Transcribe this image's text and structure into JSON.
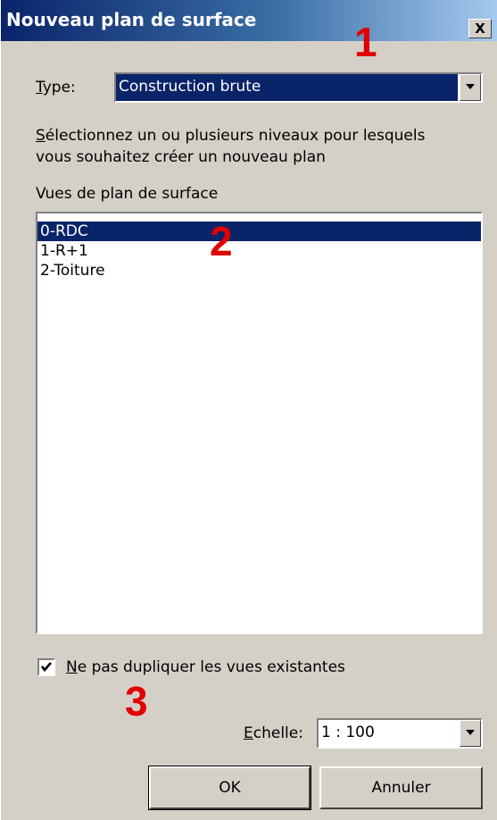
{
  "window": {
    "title": "Nouveau plan de surface",
    "close_label": "X"
  },
  "annotations": [
    "1",
    "2",
    "3"
  ],
  "type_field": {
    "label_accel": "T",
    "label_rest": "ype:",
    "value": "Construction brute"
  },
  "instructions": {
    "accel": "S",
    "line1_rest": "électionnez un ou plusieurs niveaux pour lesquels",
    "line2": "vous souhaitez créer un nouveau plan"
  },
  "views": {
    "label": "Vues de plan de surface",
    "items": [
      {
        "label": "0-RDC",
        "selected": true
      },
      {
        "label": "1-R+1",
        "selected": false
      },
      {
        "label": "2-Toiture",
        "selected": false
      }
    ]
  },
  "no_duplicate": {
    "checked": true,
    "label_accel": "N",
    "label_rest": "e pas dupliquer les vues existantes"
  },
  "scale": {
    "label_accel": "E",
    "label_rest": "chelle:",
    "value": "1 : 100"
  },
  "buttons": {
    "ok": "OK",
    "cancel": "Annuler"
  },
  "colors": {
    "annotation": "#e00000",
    "selection": "#0a246a",
    "dialog_bg": "#d4d0c8"
  }
}
